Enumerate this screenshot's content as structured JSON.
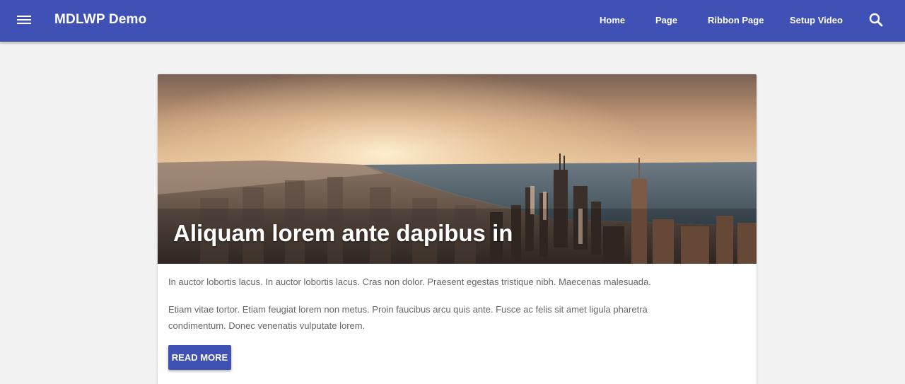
{
  "header": {
    "site_title": "MDLWP Demo",
    "nav": [
      {
        "label": "Home"
      },
      {
        "label": "Page"
      },
      {
        "label": "Ribbon Page"
      },
      {
        "label": "Setup Video"
      }
    ],
    "menu_icon": "hamburger-menu-icon",
    "search_icon": "search-icon"
  },
  "post": {
    "title": "Aliquam lorem ante dapibus in",
    "paragraph_1": "In auctor lobortis lacus. In auctor lobortis lacus. Cras non dolor. Praesent egestas tristique nibh. Maecenas malesuada.",
    "paragraph_2": "Etiam vitae tortor. Etiam feugiat lorem non metus. Proin faucibus arcu quis ante. Fusce ac felis sit amet ligula pharetra condimentum. Donec venenatis vulputate lorem.",
    "read_more_label": "READ MORE",
    "image": "city-skyline-sunset"
  },
  "colors": {
    "primary": "#3f51b5",
    "background": "#f2f2f2",
    "card": "#ffffff",
    "body_text": "#666666"
  }
}
